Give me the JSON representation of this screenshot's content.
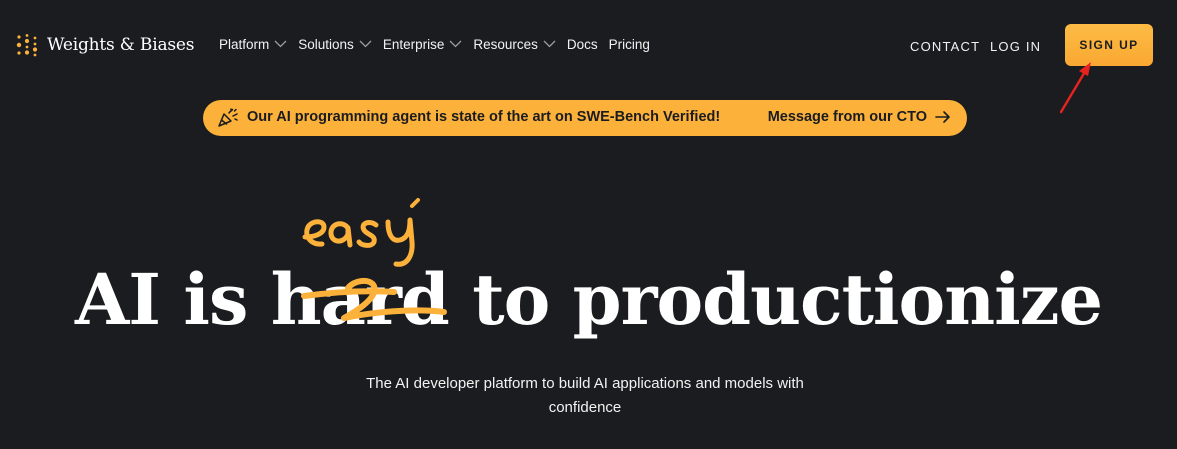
{
  "brand": {
    "name": "Weights & Biases",
    "accent": "#fcb13b",
    "background": "#1a1c1f",
    "logo_icon": "dot-grid-logo-icon"
  },
  "nav": {
    "menu": [
      {
        "label": "Platform",
        "has_dropdown": true
      },
      {
        "label": "Solutions",
        "has_dropdown": true
      },
      {
        "label": "Enterprise",
        "has_dropdown": true
      },
      {
        "label": "Resources",
        "has_dropdown": true
      },
      {
        "label": "Docs",
        "has_dropdown": false
      },
      {
        "label": "Pricing",
        "has_dropdown": false
      }
    ],
    "contact_label": "CONTACT",
    "login_label": "LOG IN",
    "signup_label": "SIGN UP"
  },
  "banner": {
    "icon": "party-popper-icon",
    "text": "Our AI programming agent is state of the art on SWE-Bench Verified!",
    "link_label": "Message from our CTO",
    "link_icon": "arrow-right-icon"
  },
  "hero": {
    "prefix": "AI is ",
    "struck_word": "hard",
    "suffix": " to productionize",
    "handwritten_word": "easy",
    "subtitle": "The AI developer platform to build AI applications and models with confidence"
  },
  "annotation": {
    "color": "#e8231f",
    "icon": "red-arrow-annotation-icon"
  }
}
